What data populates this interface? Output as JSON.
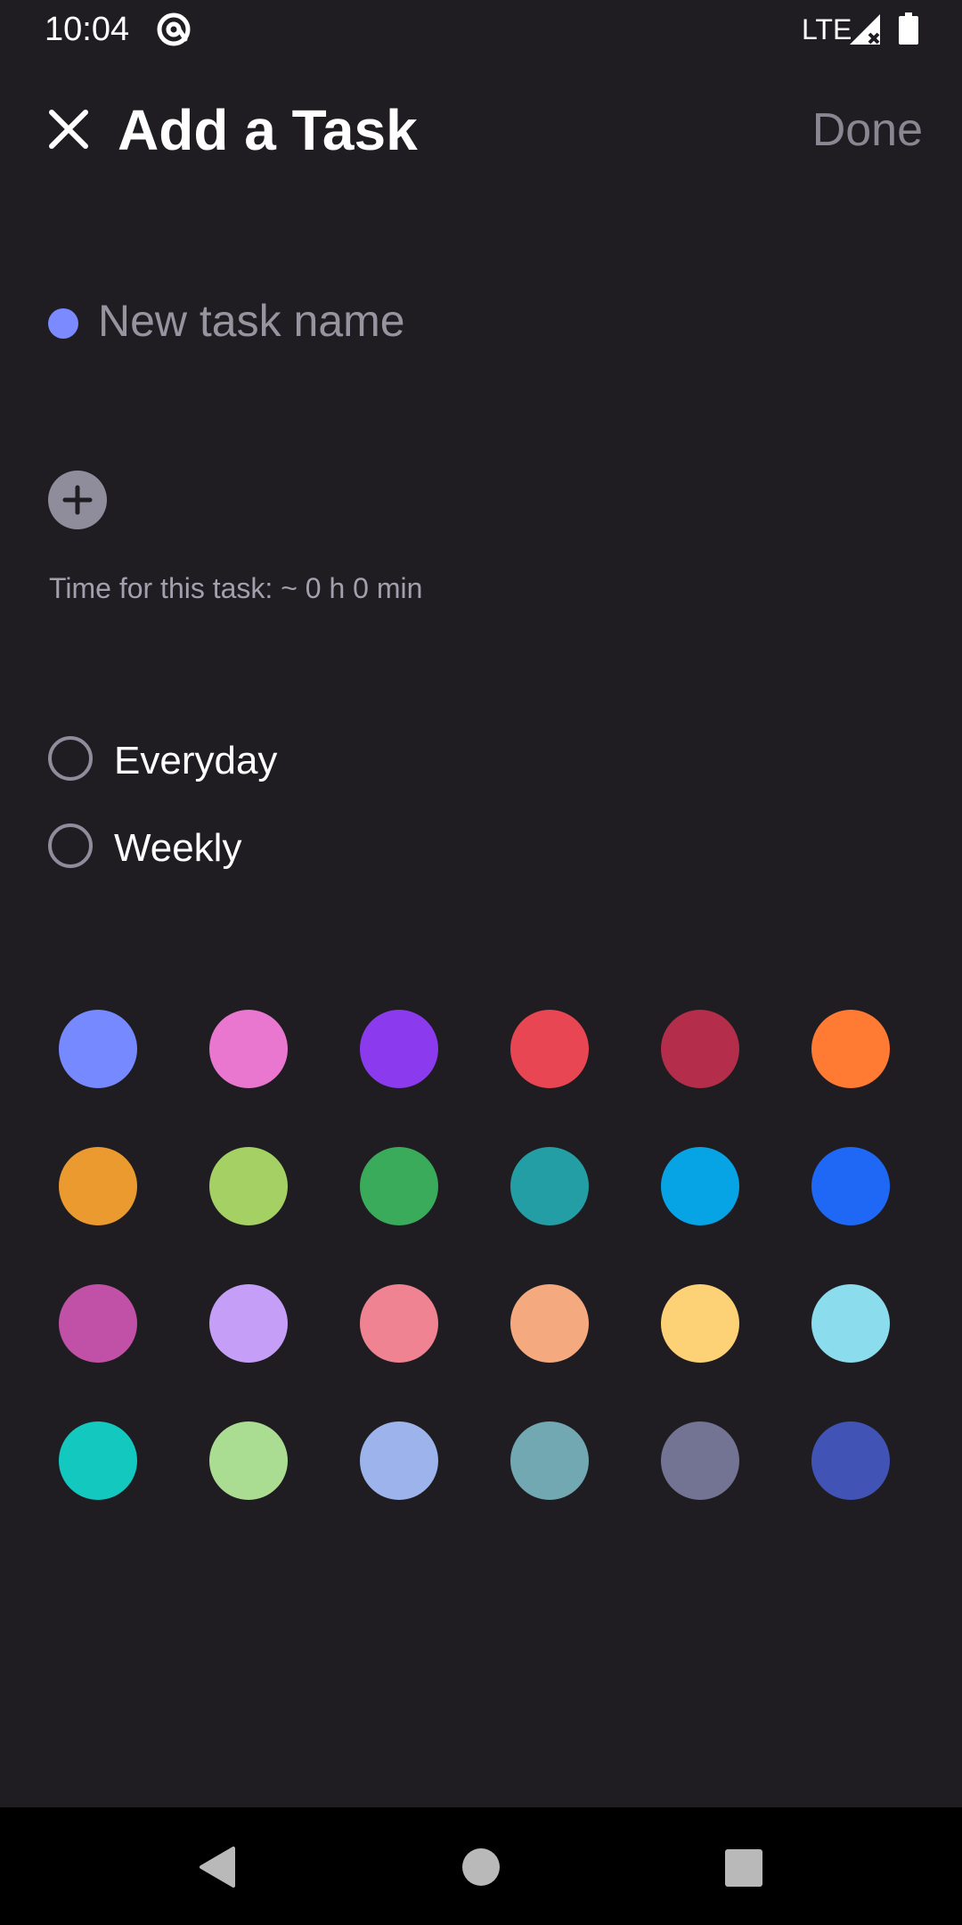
{
  "status_bar": {
    "time": "10:04",
    "app_icon": "at-sign-icon",
    "network": "LTE",
    "signal_icon": "signal-no-data-icon",
    "battery_icon": "battery-full-icon"
  },
  "header": {
    "close_icon": "close-icon",
    "title": "Add a Task",
    "done_label": "Done"
  },
  "task": {
    "dot_color": "#7b8bff",
    "name_value": "",
    "name_placeholder": "New task name"
  },
  "subtasks": {
    "add_icon": "plus-icon"
  },
  "time_estimate": {
    "text": "Time for this task: ~ 0 h 0 min"
  },
  "repeat_options": [
    {
      "label": "Everyday",
      "selected": false
    },
    {
      "label": "Weekly",
      "selected": false
    }
  ],
  "colors": [
    "#7789ff",
    "#ea77cf",
    "#8b3aee",
    "#e84652",
    "#b42d4a",
    "#ff7a32",
    "#ea9a2e",
    "#a4d064",
    "#39ab5b",
    "#229ea4",
    "#06a4e4",
    "#1f68f5",
    "#c051a6",
    "#c59ff7",
    "#ef8391",
    "#f5a97f",
    "#fdd276",
    "#8bdcec",
    "#13c8bf",
    "#aadd92",
    "#9cb3ec",
    "#72a8b1",
    "#737394",
    "#4154b6"
  ],
  "nav_bar": {
    "back_icon": "back-triangle-icon",
    "home_icon": "home-circle-icon",
    "recents_icon": "recents-square-icon"
  }
}
